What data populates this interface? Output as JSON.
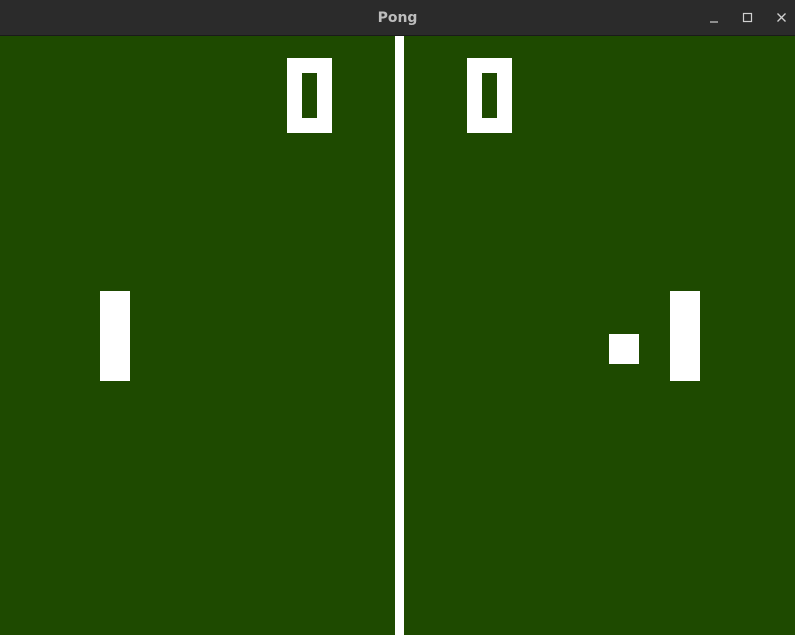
{
  "window": {
    "title": "Pong"
  },
  "colors": {
    "titlebar": "#2b2b2b",
    "title_text": "#bdbdbd",
    "field": "#1e4a00",
    "foreground": "#ffffff"
  },
  "icons": {
    "minimize": "minimize-icon",
    "maximize": "maximize-icon",
    "close": "close-icon"
  },
  "game": {
    "score_left": "0",
    "score_right": "0"
  }
}
